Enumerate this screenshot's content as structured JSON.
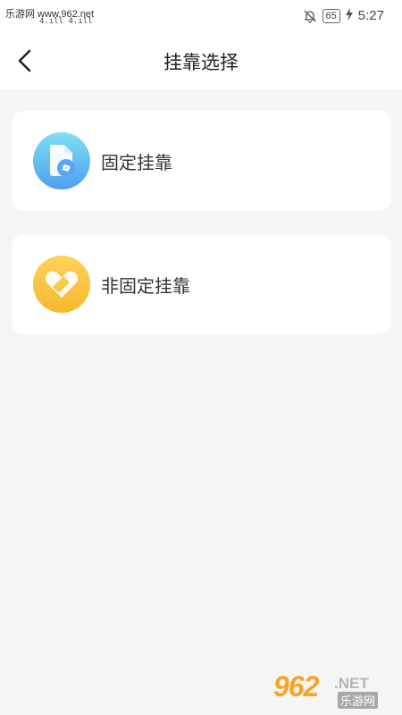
{
  "status_bar": {
    "left_text": "乐游网 www.962.net",
    "signal_text": "4.ıll 4.ıll",
    "battery": "65",
    "time": "5:27"
  },
  "header": {
    "title": "挂靠选择"
  },
  "options": [
    {
      "label": "固定挂靠",
      "icon": "document-link-icon",
      "color": "#4c9ff0"
    },
    {
      "label": "非固定挂靠",
      "icon": "heart-ticket-icon",
      "color": "#f7b92f"
    }
  ],
  "watermark": {
    "number": "962",
    "suffix": ".NET",
    "subtitle": "乐游网"
  }
}
